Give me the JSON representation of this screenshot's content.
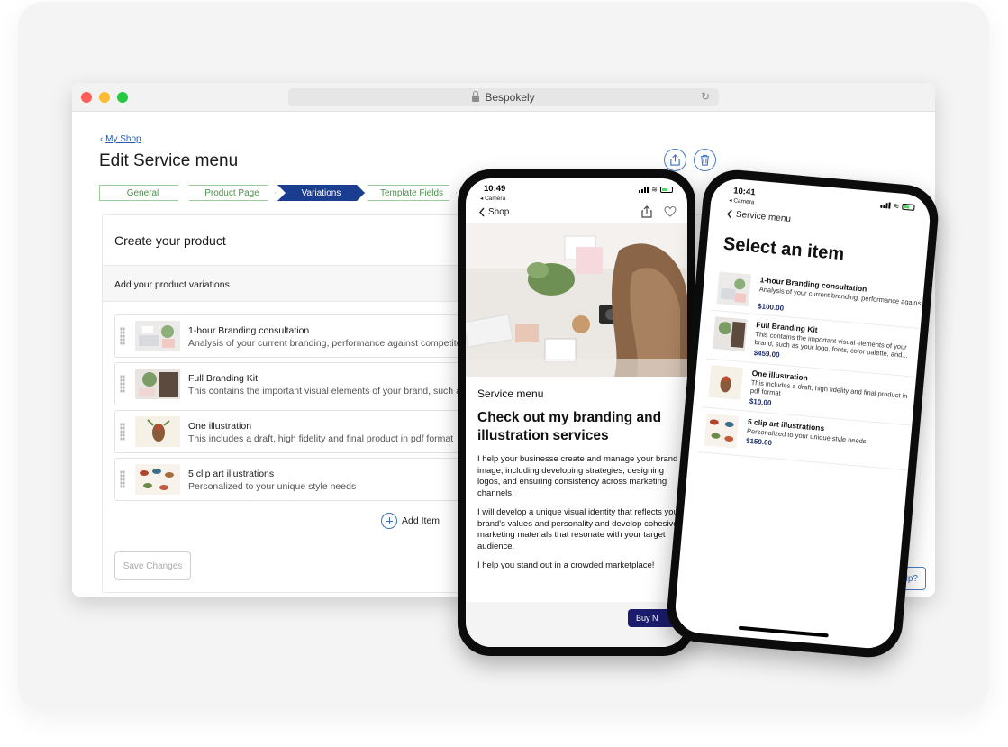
{
  "browser": {
    "url_title": "Bespokely",
    "breadcrumb": "My Shop",
    "page_title": "Edit Service menu",
    "steps": [
      "General",
      "Product Page",
      "Variations",
      "Template Fields"
    ],
    "active_step": "Variations",
    "panel_title": "Create your product",
    "panel_subtitle": "Add your product variations",
    "items": [
      {
        "name": "1-hour Branding consultation",
        "desc": "Analysis of your current branding, performance against competito"
      },
      {
        "name": "Full Branding Kit",
        "desc": "This contains the important visual elements of your brand, such as"
      },
      {
        "name": "One illustration",
        "desc": "This includes a draft, high fidelity and final product in pdf format"
      },
      {
        "name": "5 clip art illustrations",
        "desc": "Personalized to your unique style needs"
      }
    ],
    "add_item_label": "Add Item",
    "save_label": "Save Changes",
    "help_label": "elp?"
  },
  "phone_shop": {
    "time": "10:49",
    "camera_back": "◂ Camera",
    "back_label": "Shop",
    "label": "Service menu",
    "heading": "Check out my branding and illustration services",
    "paragraphs": [
      "I help your businesse create and manage your brand image, including developing strategies, designing logos, and ensuring consistency across marketing channels.",
      "I will develop a unique visual identity that reflects your brand's values and personality and develop cohesive marketing materials that resonate with your target audience.",
      "I help you stand out in a crowded marketplace!"
    ],
    "buy_label": "Buy N"
  },
  "phone_menu": {
    "time": "10:41",
    "camera_back": "◂ Camera",
    "back_label": "Service menu",
    "title": "Select an item",
    "items": [
      {
        "name": "1-hour Branding consultation",
        "desc": "Analysis of your current branding, performance against competitors, improvements and general mar...",
        "price": "$100.00"
      },
      {
        "name": "Full Branding Kit",
        "desc": "This contains the important visual elements of your brand, such as your logo, fonts, color palette, and...",
        "price": "$459.00"
      },
      {
        "name": "One illustration",
        "desc": "This includes a draft, high fidelity and final product in pdf format",
        "price": "$10.00"
      },
      {
        "name": "5 clip art illustrations",
        "desc": "Personalized to your unique style needs",
        "price": "$159.00"
      }
    ]
  },
  "colors": {
    "accent": "#1b3d8f",
    "link": "#2a5db0",
    "step_done": "#4f8f4f",
    "price": "#1c2a6e"
  }
}
